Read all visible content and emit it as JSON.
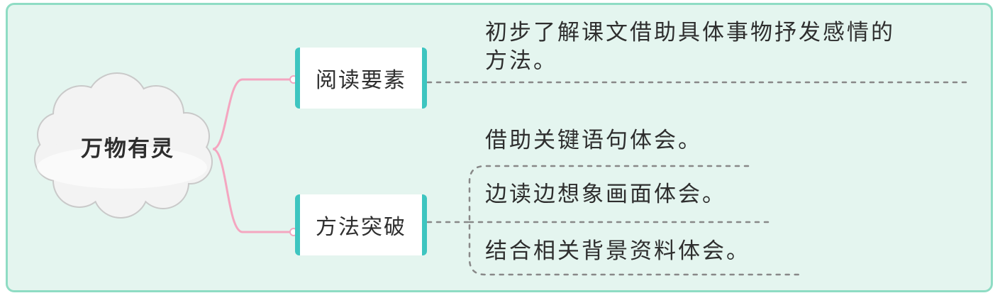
{
  "root": {
    "label": "万物有灵"
  },
  "branches": [
    {
      "label": "阅读要素",
      "leaves": [
        {
          "lines": [
            "初步了解课文借助具体事物抒发感情的",
            "方法。"
          ]
        }
      ]
    },
    {
      "label": "方法突破",
      "leaves": [
        {
          "lines": [
            "借助关键语句体会。"
          ]
        },
        {
          "lines": [
            "边读边想象画面体会。"
          ]
        },
        {
          "lines": [
            "结合相关背景资料体会。"
          ]
        }
      ]
    }
  ],
  "colors": {
    "panel_background": "#e4f5ef",
    "panel_border": "#8fdcc4",
    "connector": "#f4a6c0",
    "topic_accent": "#3ec5c0",
    "cloud_fill": "#f3f3f3",
    "cloud_stroke": "#c9c9c9",
    "dotted_line": "#888888"
  },
  "icons": {
    "root_shape": "cloud-shape"
  }
}
